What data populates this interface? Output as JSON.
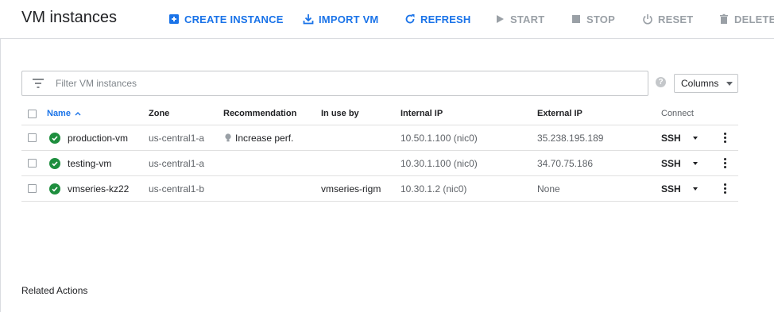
{
  "header": {
    "title": "VM instances",
    "actions": [
      {
        "label": "CREATE INSTANCE",
        "icon": "add-box-icon",
        "enabled": true
      },
      {
        "label": "IMPORT VM",
        "icon": "download-icon",
        "enabled": true
      },
      {
        "label": "REFRESH",
        "icon": "refresh-icon",
        "enabled": true
      },
      {
        "label": "START",
        "icon": "play-icon",
        "enabled": false
      },
      {
        "label": "STOP",
        "icon": "stop-icon",
        "enabled": false
      },
      {
        "label": "RESET",
        "icon": "power-icon",
        "enabled": false
      },
      {
        "label": "DELETE",
        "icon": "trash-icon",
        "enabled": false
      }
    ]
  },
  "filter": {
    "placeholder": "Filter VM instances",
    "value": ""
  },
  "help_icon_glyph": "?",
  "columns_button": {
    "label": "Columns"
  },
  "table": {
    "headers": {
      "name": "Name",
      "zone": "Zone",
      "recommendation": "Recommendation",
      "in_use_by": "In use by",
      "internal_ip": "Internal IP",
      "external_ip": "External IP",
      "connect": "Connect"
    },
    "rows": [
      {
        "status": "running",
        "name": "production-vm",
        "zone": "us-central1-a",
        "recommendation": "Increase perf.",
        "in_use_by": "",
        "internal_ip": "10.50.1.100 (nic0)",
        "external_ip": "35.238.195.189",
        "connect": "SSH"
      },
      {
        "status": "running",
        "name": "testing-vm",
        "zone": "us-central1-a",
        "recommendation": "",
        "in_use_by": "",
        "internal_ip": "10.30.1.100 (nic0)",
        "external_ip": "34.70.75.186",
        "connect": "SSH"
      },
      {
        "status": "running",
        "name": "vmseries-kz22",
        "zone": "us-central1-b",
        "recommendation": "",
        "in_use_by": "vmseries-rigm",
        "internal_ip": "10.30.1.2 (nic0)",
        "external_ip": "None",
        "connect": "SSH"
      }
    ]
  },
  "related_actions": {
    "label": "Related Actions"
  },
  "colors": {
    "accent": "#1a73e8",
    "disabled": "#9aa0a6",
    "status_ok": "#1e8e3e",
    "divider": "#dadce0"
  }
}
